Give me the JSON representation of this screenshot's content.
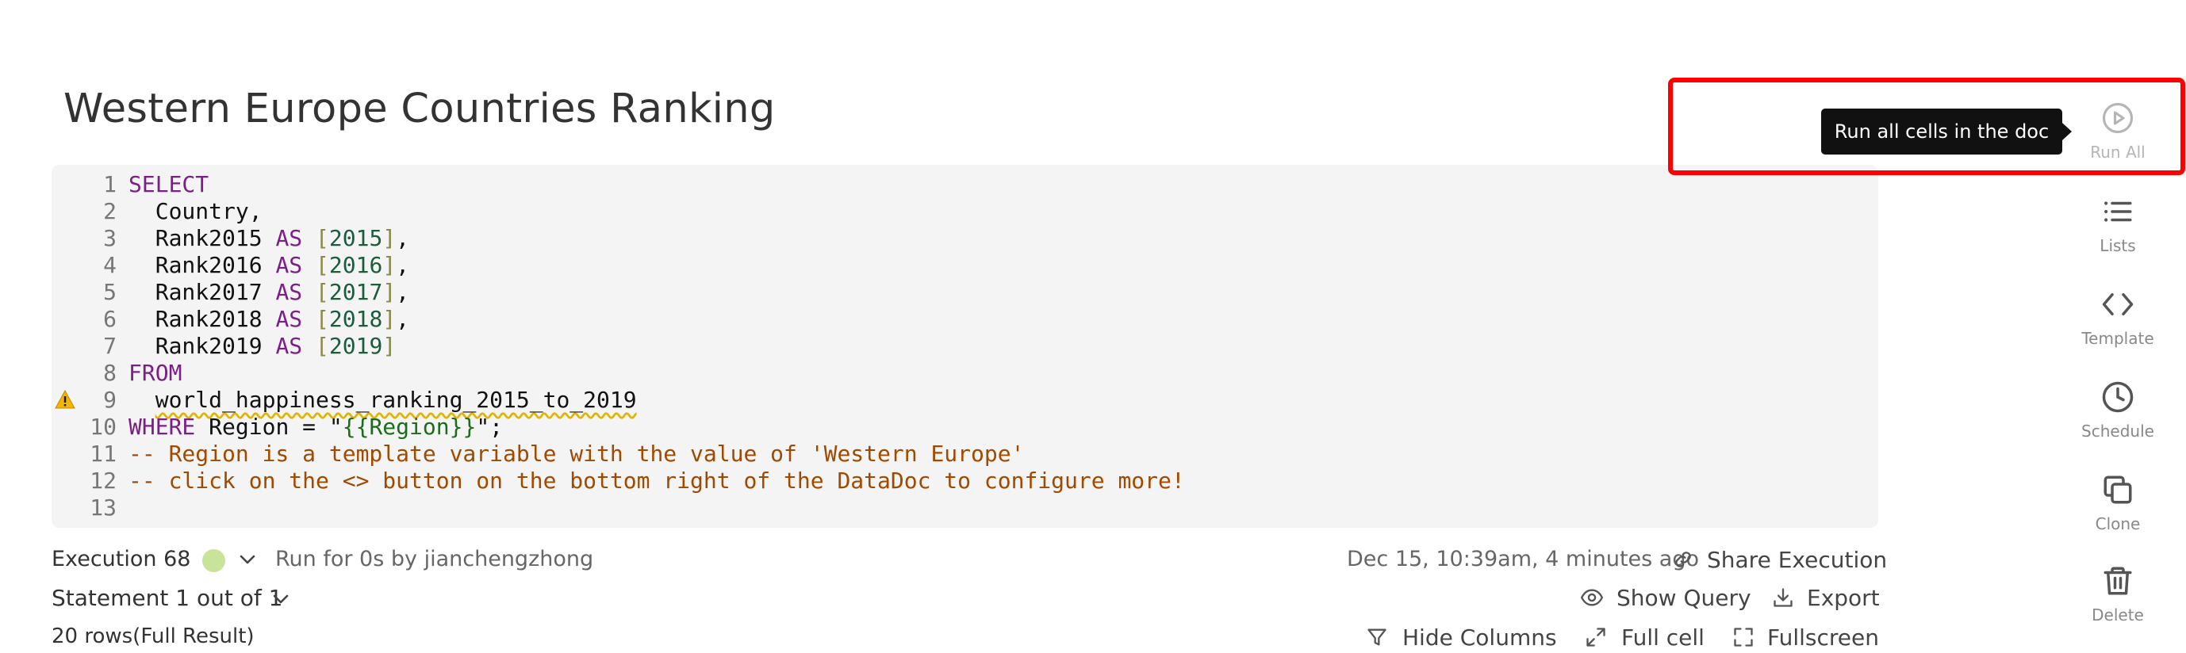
{
  "doc": {
    "title": "Western Europe Countries Ranking"
  },
  "editor": {
    "lines": [
      {
        "n": "1",
        "segments": [
          [
            "kw",
            "SELECT"
          ]
        ]
      },
      {
        "n": "2",
        "segments": [
          [
            "plain",
            "  Country,"
          ]
        ]
      },
      {
        "n": "3",
        "segments": [
          [
            "plain",
            "  Rank2015 "
          ],
          [
            "kw",
            "AS"
          ],
          [
            "plain",
            " "
          ],
          [
            "br",
            "["
          ],
          [
            "num",
            "2015"
          ],
          [
            "br",
            "]"
          ],
          [
            "plain",
            ","
          ]
        ]
      },
      {
        "n": "4",
        "segments": [
          [
            "plain",
            "  Rank2016 "
          ],
          [
            "kw",
            "AS"
          ],
          [
            "plain",
            " "
          ],
          [
            "br",
            "["
          ],
          [
            "num",
            "2016"
          ],
          [
            "br",
            "]"
          ],
          [
            "plain",
            ","
          ]
        ]
      },
      {
        "n": "5",
        "segments": [
          [
            "plain",
            "  Rank2017 "
          ],
          [
            "kw",
            "AS"
          ],
          [
            "plain",
            " "
          ],
          [
            "br",
            "["
          ],
          [
            "num",
            "2017"
          ],
          [
            "br",
            "]"
          ],
          [
            "plain",
            ","
          ]
        ]
      },
      {
        "n": "6",
        "segments": [
          [
            "plain",
            "  Rank2018 "
          ],
          [
            "kw",
            "AS"
          ],
          [
            "plain",
            " "
          ],
          [
            "br",
            "["
          ],
          [
            "num",
            "2018"
          ],
          [
            "br",
            "]"
          ],
          [
            "plain",
            ","
          ]
        ]
      },
      {
        "n": "7",
        "segments": [
          [
            "plain",
            "  Rank2019 "
          ],
          [
            "kw",
            "AS"
          ],
          [
            "plain",
            " "
          ],
          [
            "br",
            "["
          ],
          [
            "num",
            "2019"
          ],
          [
            "br",
            "]"
          ]
        ]
      },
      {
        "n": "8",
        "segments": [
          [
            "kw",
            "FROM"
          ]
        ]
      },
      {
        "n": "9",
        "segments": [
          [
            "plain",
            "  "
          ],
          [
            "warn",
            "world_happiness_ranking_2015_to_2019"
          ]
        ],
        "warning": true
      },
      {
        "n": "10",
        "segments": [
          [
            "kw",
            "WHERE"
          ],
          [
            "plain",
            " Region = \""
          ],
          [
            "str",
            "{{Region}}"
          ],
          [
            "plain",
            "\";"
          ]
        ]
      },
      {
        "n": "11",
        "segments": [
          [
            "cmt",
            "-- Region is a template variable with the value of 'Western Europe'"
          ]
        ]
      },
      {
        "n": "12",
        "segments": [
          [
            "cmt",
            "-- click on the <> button on the bottom right of the DataDoc to configure more!"
          ]
        ]
      },
      {
        "n": "13",
        "segments": []
      }
    ]
  },
  "execution": {
    "label": "Execution 68",
    "run_info": "Run for 0s by jianchengzhong",
    "timestamp": "Dec 15, 10:39am, 4 minutes ago",
    "share_label": "Share Execution",
    "statement_label": "Statement 1 out of 1",
    "show_query_label": "Show Query",
    "export_label": "Export",
    "rows_label": "20 rows(Full Result)",
    "hide_columns_label": "Hide Columns",
    "full_cell_label": "Full cell",
    "fullscreen_label": "Fullscreen",
    "status_color": "#c9e39a"
  },
  "sidebar": {
    "run_all_label": "Run All",
    "lists_label": "Lists",
    "template_label": "Template",
    "schedule_label": "Schedule",
    "clone_label": "Clone",
    "delete_label": "Delete"
  },
  "tooltip": {
    "text": "Run all cells in the doc"
  },
  "colors": {
    "highlight": "#ff0000",
    "keyword": "#7a1f86",
    "comment": "#a04a00"
  }
}
